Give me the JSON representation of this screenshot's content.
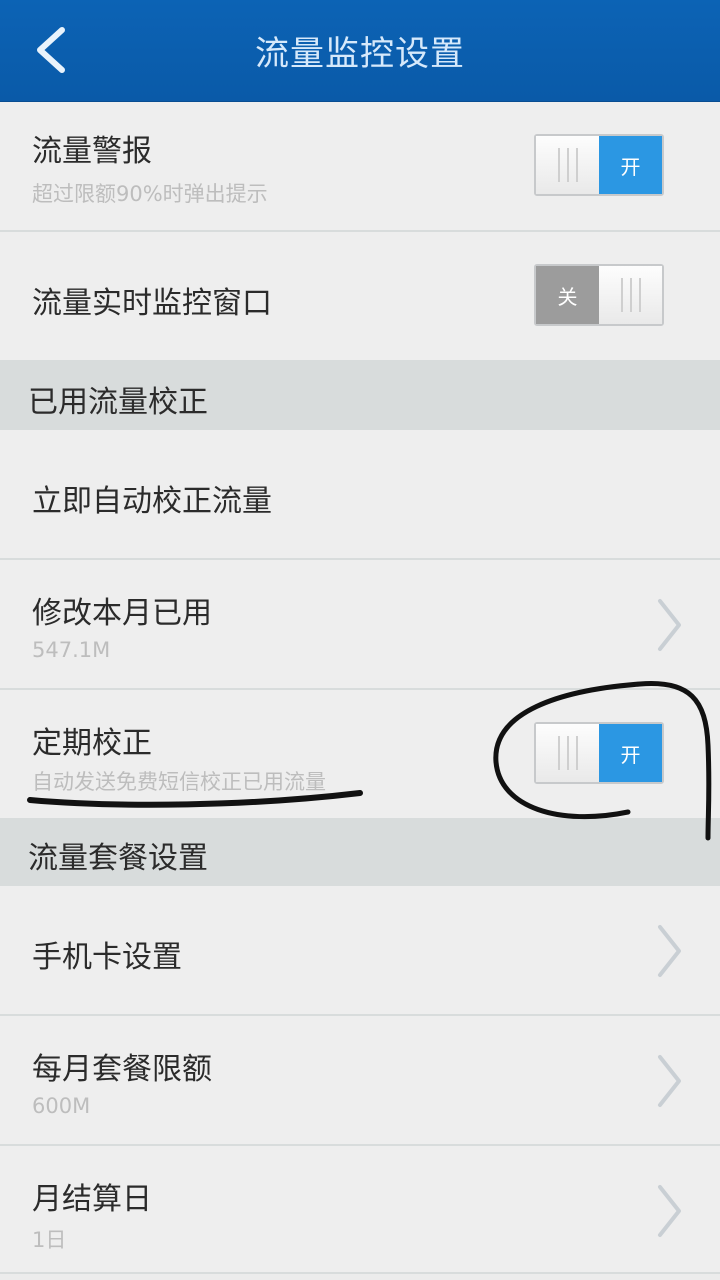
{
  "header": {
    "title": "流量监控设置"
  },
  "rows": {
    "alert": {
      "title": "流量警报",
      "subtitle": "超过限额90%时弹出提示",
      "toggle_label": "开",
      "state": "on"
    },
    "realtime_window": {
      "title": "流量实时监控窗口",
      "toggle_label": "关",
      "state": "off"
    },
    "auto_correct": {
      "title": "立即自动校正流量"
    },
    "modify_used": {
      "title": "修改本月已用",
      "value": "547.1M"
    },
    "periodic_correct": {
      "title": "定期校正",
      "subtitle": "自动发送免费短信校正已用流量",
      "toggle_label": "开",
      "state": "on"
    },
    "sim_settings": {
      "title": "手机卡设置"
    },
    "monthly_limit": {
      "title": "每月套餐限额",
      "value": "600M"
    },
    "billing_day": {
      "title": "月结算日",
      "value": "1日"
    }
  },
  "sections": {
    "used_correction": "已用流量校正",
    "plan_settings": "流量套餐设置"
  },
  "colors": {
    "header": "#0c63b5",
    "toggle_on": "#2b97e3",
    "toggle_off": "#9c9c9c",
    "annotation_ink": "#111111"
  },
  "icons": {
    "back": "chevron-left-icon",
    "row_arrow": "chevron-right-icon"
  }
}
